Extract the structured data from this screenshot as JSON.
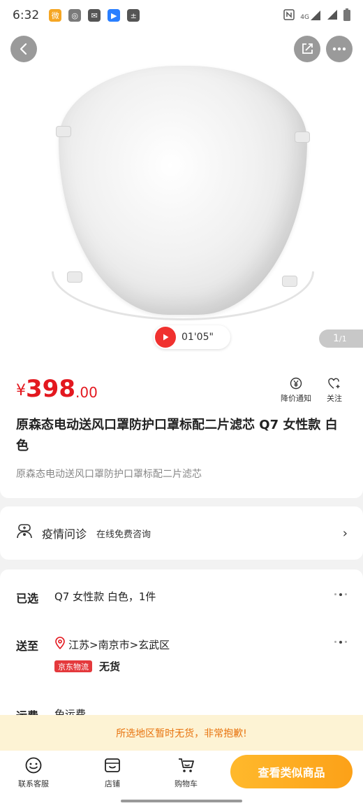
{
  "status_bar": {
    "time": "6:32",
    "left_icons": [
      "weibo-icon",
      "wechat-icon",
      "mail-icon",
      "youku-icon",
      "calculator-icon"
    ],
    "right_icons": [
      "nfc-icon",
      "signal-4g-icon",
      "signal-icon",
      "battery-icon"
    ],
    "network": "4G"
  },
  "hero": {
    "video_duration": "01'05\"",
    "page_current": "1",
    "page_total": "/1"
  },
  "price": {
    "currency": "¥",
    "integer": "398",
    "decimal": ".00",
    "color": "#e3181f"
  },
  "price_actions": [
    {
      "label": "降价通知",
      "icon": "price-drop-icon"
    },
    {
      "label": "关注",
      "icon": "heart-plus-icon"
    }
  ],
  "product": {
    "title": "原森态电动送风口罩防护口罩标配二片滤芯 Q7 女性款   白色",
    "subtitle": "原森态电动送风口罩防护口罩标配二片滤芯"
  },
  "consult": {
    "label": "疫情问诊",
    "subtitle": "在线免费咨询"
  },
  "selection": {
    "selected_label": "已选",
    "selected_value": "Q7 女性款   白色，1件",
    "ship_label": "送至",
    "address": "江苏>南京市>玄武区",
    "logistics": "京东物流",
    "stock": "无货",
    "freight_label": "运费",
    "freight_value": "免运费"
  },
  "notice": {
    "text": "所选地区暂时无货，非常抱歉!",
    "color": "#e8730e"
  },
  "bottom_bar": {
    "tabs": [
      {
        "label": "联系客服",
        "icon": "customer-service-icon"
      },
      {
        "label": "店铺",
        "icon": "store-icon"
      },
      {
        "label": "购物车",
        "icon": "cart-icon"
      }
    ],
    "cta_label": "查看类似商品",
    "cta_color": "#fca118"
  }
}
